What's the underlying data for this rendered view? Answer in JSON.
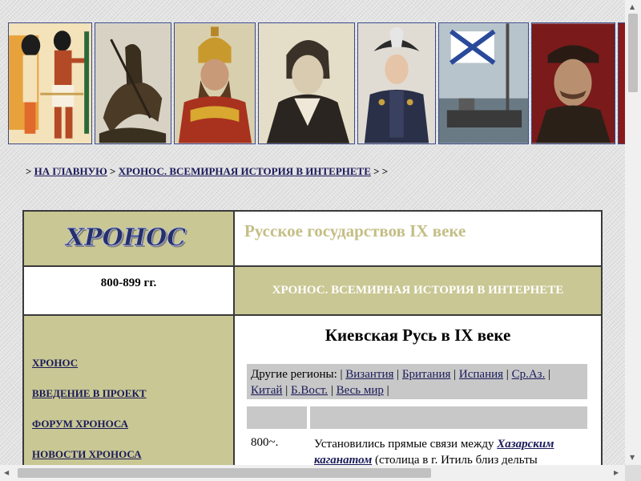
{
  "breadcrumb": {
    "prefix": ">",
    "home": "НА ГЛАВНУЮ",
    "sep": ">",
    "section": "ХРОНОС. ВСЕМИРНАЯ ИСТОРИЯ В ИНТЕРНЕТЕ",
    "suffix": "> >"
  },
  "logo": {
    "text": "ХРОНОС"
  },
  "page": {
    "title": "Русское государствов IX веке"
  },
  "sidebar": {
    "date_range": "800-899 гг.",
    "menu": [
      {
        "label": "ХРОНОС"
      },
      {
        "label": "ВВЕДЕНИЕ В ПРОЕКТ"
      },
      {
        "label": "ФОРУМ ХРОНОСА"
      },
      {
        "label": "НОВОСТИ ХРОНОСА"
      }
    ]
  },
  "band": {
    "text": "ХРОНОС. ВСЕМИРНАЯ ИСТОРИЯ В ИНТЕРНЕТЕ"
  },
  "content": {
    "heading": "Киевская Русь в IX веке",
    "regions_label": "Другие регионы:",
    "regions": [
      "Византия",
      "Британия",
      "Испания",
      "Ср.Аз.",
      "Китай",
      "Б.Вост.",
      "Весь мир"
    ],
    "separator": "|",
    "rows": [
      {
        "year": "800~.",
        "text_before": "Установились прямые связи между",
        "link": "Хазарским каганатом",
        "text_after": "(столица в г. Итиль близ дельты"
      }
    ]
  },
  "banner": {
    "images": [
      "egyptian-fresco",
      "st-george-statue",
      "tsar-portrait",
      "napoleon-portrait",
      "officer-portrait",
      "naval-flag-painting",
      "worker-portrait"
    ]
  },
  "colors": {
    "khaki": "#c9c793",
    "link": "#1a1a5a",
    "title": "#c4be85"
  }
}
